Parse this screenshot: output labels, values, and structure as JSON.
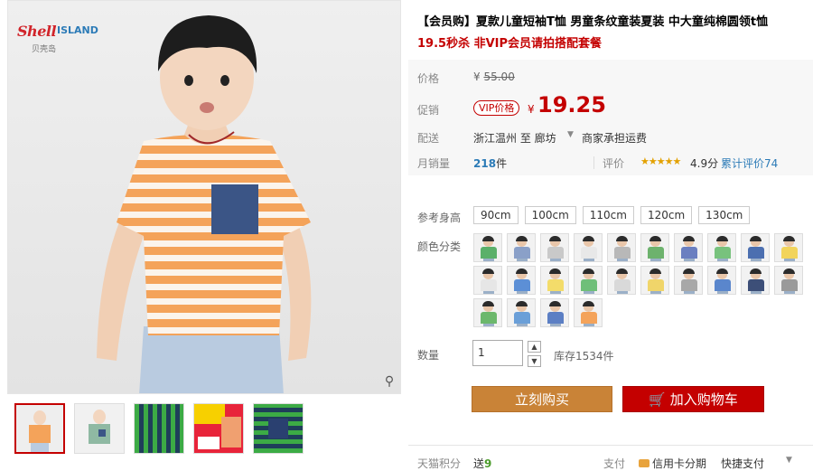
{
  "brand": {
    "logo_text": "Shell",
    "logo_text2": "ISLAND",
    "logo_cn": "贝壳岛"
  },
  "product": {
    "title": "【会员购】夏款儿童短袖T恤 男童条纹童装夏装 中大童纯棉圆领t恤",
    "subtitle": "19.5秒杀 非VIP会员请拍搭配套餐"
  },
  "price": {
    "label": "价格",
    "currency": "¥",
    "original": "55.00",
    "promo_label": "促销",
    "vip_tag": "VIP价格",
    "promo_currency": "¥",
    "promo_value": "19.25"
  },
  "shipping": {
    "label": "配送",
    "text": "浙江温州 至 廊坊",
    "arrow": "▼",
    "method": "商家承担运费"
  },
  "sales": {
    "label": "月销量",
    "count": "218",
    "unit": "件",
    "review_label": "评价",
    "stars": "★★★★★",
    "rating": "4.9分",
    "total_reviews": "累计评价74"
  },
  "size": {
    "label": "参考身高",
    "options": [
      "90cm",
      "100cm",
      "110cm",
      "120cm",
      "130cm"
    ]
  },
  "color": {
    "label": "颜色分类"
  },
  "quantity": {
    "label": "数量",
    "value": "1",
    "up": "▲",
    "down": "▼",
    "stock": "库存1534件"
  },
  "actions": {
    "buy": "立刻购买",
    "cart_icon": "🛒",
    "cart": "加入购物车"
  },
  "footer": {
    "points_label": "天猫积分",
    "points_prefix": "送",
    "points_value": "9",
    "pay_label": "支付",
    "pay_method1": "信用卡分期",
    "pay_method2": "快捷支付"
  },
  "colors": {
    "accent": "#c40000",
    "buy": "#c98337",
    "link": "#2c7bb7"
  },
  "icons": {
    "zoom": "magnifier-icon",
    "cart": "cart-icon"
  }
}
